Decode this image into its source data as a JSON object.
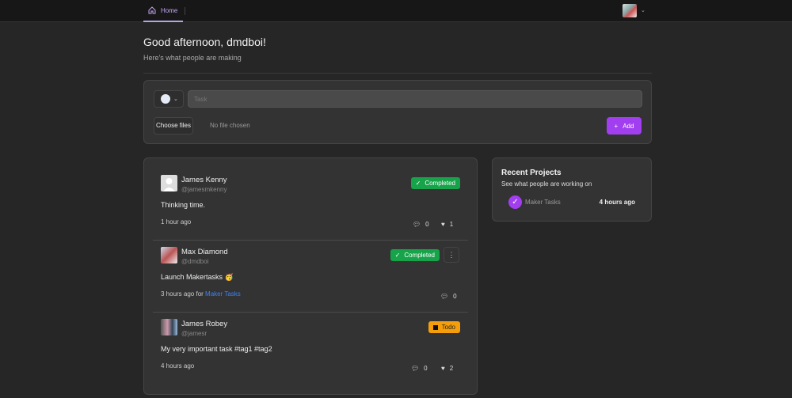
{
  "nav": {
    "home_label": "Home"
  },
  "header": {
    "greeting": "Good afternoon, dmdboi!",
    "subtitle": "Here's what people are making"
  },
  "composer": {
    "task_placeholder": "Task",
    "choose_files_label": "Choose files",
    "no_file_text": "No file chosen",
    "add_label": "Add"
  },
  "posts": [
    {
      "name": "James Kenny",
      "username": "@jamesmkenny",
      "status": "Completed",
      "body": "Thinking time.",
      "time": "1 hour ago",
      "comments": "0",
      "likes": "1"
    },
    {
      "name": "Max Diamond",
      "username": "@dmdboi",
      "status": "Completed",
      "body": "Launch Makertasks 🥳",
      "time": "3 hours ago for",
      "project": "Maker Tasks",
      "comments": "0"
    },
    {
      "name": "James Robey",
      "username": "@jamesr",
      "status": "Todo",
      "body": "My very important task #tag1 #tag2",
      "time": "4 hours ago",
      "comments": "0",
      "likes": "2"
    }
  ],
  "recent_projects": {
    "title": "Recent Projects",
    "subtitle": "See what people are working on",
    "items": [
      {
        "name": "Maker Tasks",
        "time": "4 hours ago"
      }
    ]
  },
  "colors": {
    "accent": "#a13ff0",
    "completed": "#16a34a",
    "todo": "#f59e0b",
    "link": "#3b82f6"
  }
}
